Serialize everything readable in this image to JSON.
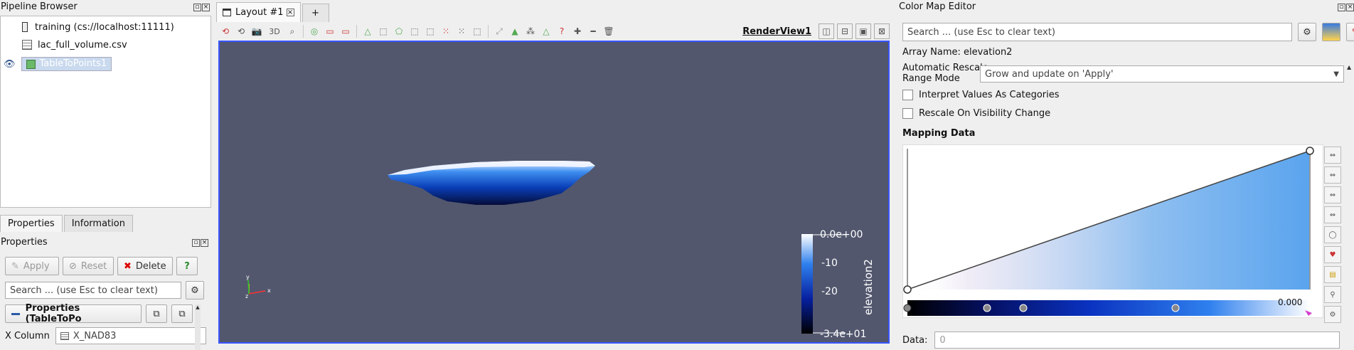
{
  "pipeline_browser": {
    "title": "Pipeline Browser",
    "items": [
      {
        "label": "training (cs://localhost:11111)"
      },
      {
        "label": "lac_full_volume.csv"
      },
      {
        "label": "TableToPoints1"
      }
    ]
  },
  "properties_tabs": {
    "properties": "Properties",
    "information": "Information"
  },
  "properties": {
    "title": "Properties",
    "apply": "Apply",
    "reset": "Reset",
    "delete": "Delete",
    "help": "?",
    "search_placeholder": "Search ... (use Esc to clear text)",
    "section_title": "Properties (TableToPo",
    "x_column_label": "X Column",
    "x_column_value": "X_NAD83"
  },
  "layout": {
    "tab_label": "Layout #1",
    "add_tab": "+",
    "view_name": "RenderView1",
    "toolbar_3d": "3D"
  },
  "colorbar": {
    "title": "elevation2",
    "labels": [
      "0.0e+00",
      "-10",
      "-20",
      "-3.4e+01"
    ]
  },
  "axes": {
    "x": "x",
    "y": "y",
    "z": "z"
  },
  "color_map_editor": {
    "title": "Color Map Editor",
    "search_placeholder": "Search ... (use Esc to clear text)",
    "array_name": "Array Name: elevation2",
    "rescale_label_1": "Automatic Rescale",
    "rescale_label_2": "Range Mode",
    "rescale_value": "Grow and update on 'Apply'",
    "interpret_categories": "Interpret Values As Categories",
    "rescale_visibility": "Rescale On Visibility Change",
    "mapping_data": "Mapping Data",
    "range_value": "0.000",
    "data_label": "Data:",
    "data_value": "0"
  },
  "colors": {
    "render_bg": "#52576e",
    "accent_border": "#3a55ff"
  }
}
